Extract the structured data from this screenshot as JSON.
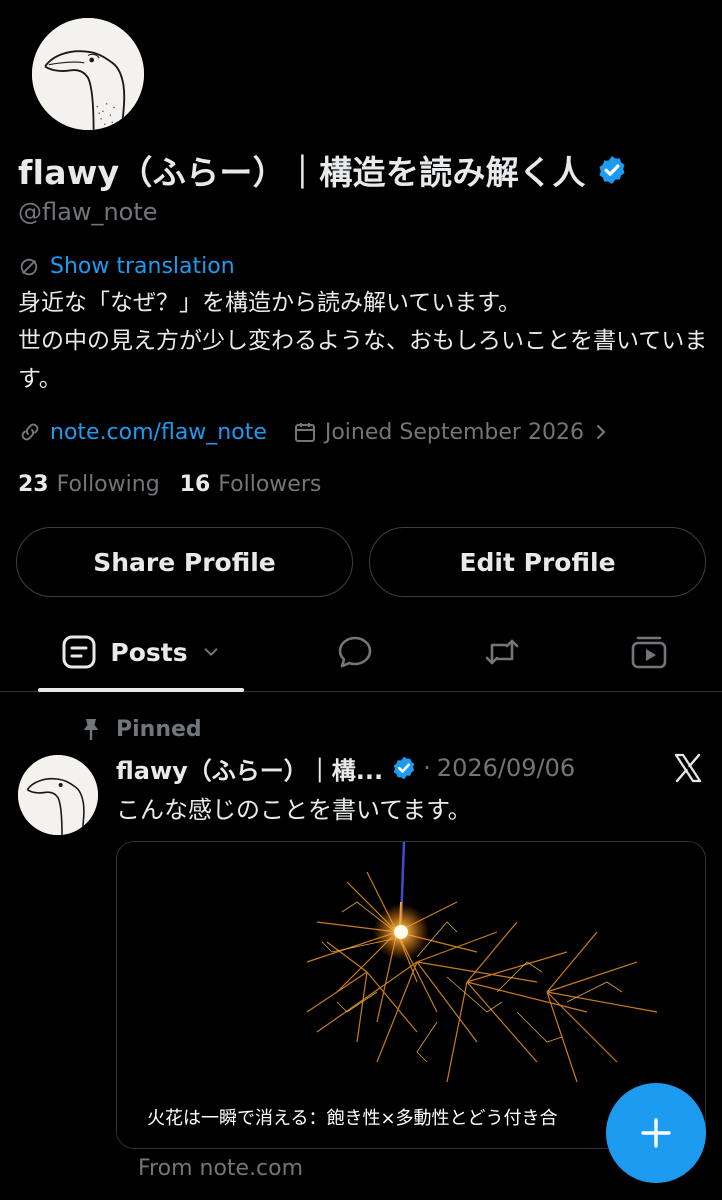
{
  "profile": {
    "display_name": "flawy（ふらー）｜構造を読み解く人",
    "handle": "@flaw_note",
    "show_translation": "Show translation",
    "bio": "身近な「なぜ？」を構造から読み解いています。\n世の中の見え方が少し変わるような、おもしろいことを書いています。",
    "link": "note.com/flaw_note",
    "joined": "Joined September 2026",
    "following_count": "23",
    "following_label": "Following",
    "followers_count": "16",
    "followers_label": "Followers"
  },
  "actions": {
    "share": "Share Profile",
    "edit": "Edit Profile"
  },
  "tabs": {
    "posts": "Posts",
    "icons": [
      "reply-icon",
      "repost-icon",
      "media-icon"
    ]
  },
  "post": {
    "pinned_label": "Pinned",
    "author": "flawy（ふらー）｜構...",
    "separator": "·",
    "date": "2026/09/06",
    "text": "こんな感じのことを書いてます。",
    "card_caption": "火花は一瞬で消える：飽き性×多動性とどう付き合",
    "source": "From note.com"
  },
  "colors": {
    "background": "#000000",
    "accent": "#1d9bf0",
    "text": "#e7e9ea",
    "muted": "#71767b",
    "border": "#2f3336"
  }
}
